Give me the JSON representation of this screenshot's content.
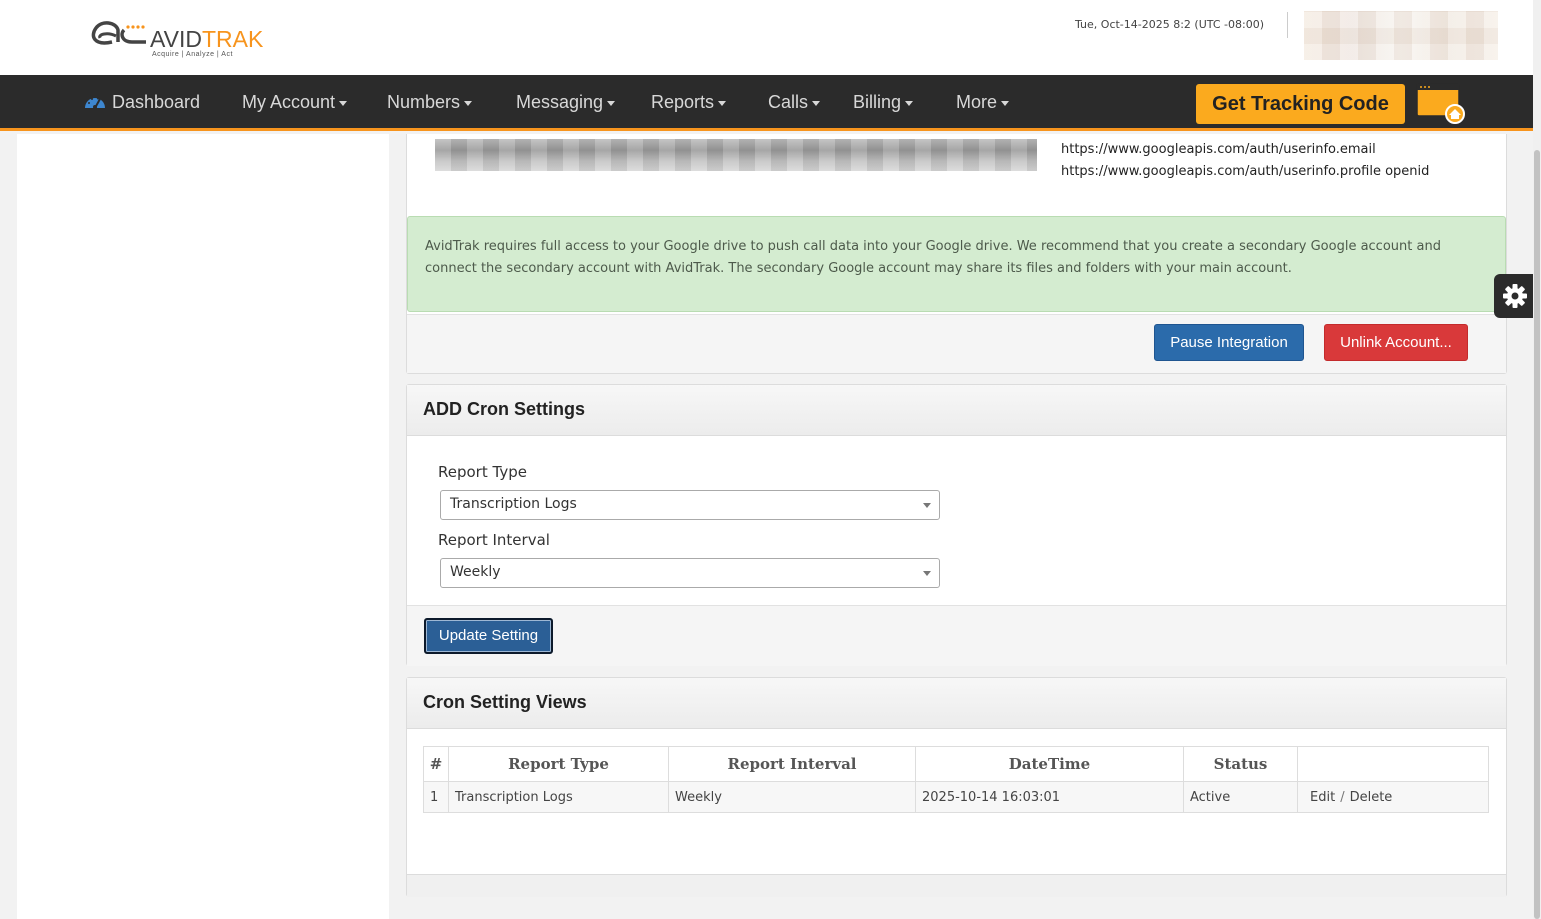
{
  "header": {
    "logo_text_a": "AVID",
    "logo_text_b": "TRAK",
    "logo_tagline": "Acquire  |  Analyze  |  Act",
    "datetime": "Tue, Oct-14-2025 8:2 (UTC -08:00)"
  },
  "nav": {
    "items": [
      {
        "label": "Dashboard"
      },
      {
        "label": "My Account"
      },
      {
        "label": "Numbers"
      },
      {
        "label": "Messaging"
      },
      {
        "label": "Reports"
      },
      {
        "label": "Calls"
      },
      {
        "label": "Billing"
      },
      {
        "label": "More"
      }
    ],
    "tracking_button": "Get Tracking Code"
  },
  "integration": {
    "scopes": [
      "https://www.googleapis.com/auth/userinfo.email",
      "https://www.googleapis.com/auth/userinfo.profile openid"
    ],
    "alert": "AvidTrak requires full access to your Google drive to push call data into your Google drive. We recommend that you create a secondary Google account and connect the secondary account with AvidTrak. The secondary Google account may share its files and folders with your main account.",
    "pause_label": "Pause Integration",
    "unlink_label": "Unlink Account..."
  },
  "cron_form": {
    "title": "ADD Cron Settings",
    "report_type_label": "Report Type",
    "report_type_value": "Transcription Logs",
    "report_interval_label": "Report Interval",
    "report_interval_value": "Weekly",
    "submit_label": "Update Setting"
  },
  "cron_views": {
    "title": "Cron Setting Views",
    "columns": [
      "#",
      "Report Type",
      "Report Interval",
      "DateTime",
      "Status",
      ""
    ],
    "rows": [
      {
        "num": "1",
        "report_type": "Transcription Logs",
        "interval": "Weekly",
        "datetime": "2025-10-14 16:03:01",
        "status": "Active",
        "edit": "Edit",
        "sep": "/",
        "delete": "Delete"
      }
    ]
  },
  "colors": {
    "accent": "#f7941d",
    "navbar": "#2b2b2b",
    "primary_button": "#2b6bab",
    "danger_button": "#d9393a",
    "alert_bg": "#d4ecd0"
  }
}
